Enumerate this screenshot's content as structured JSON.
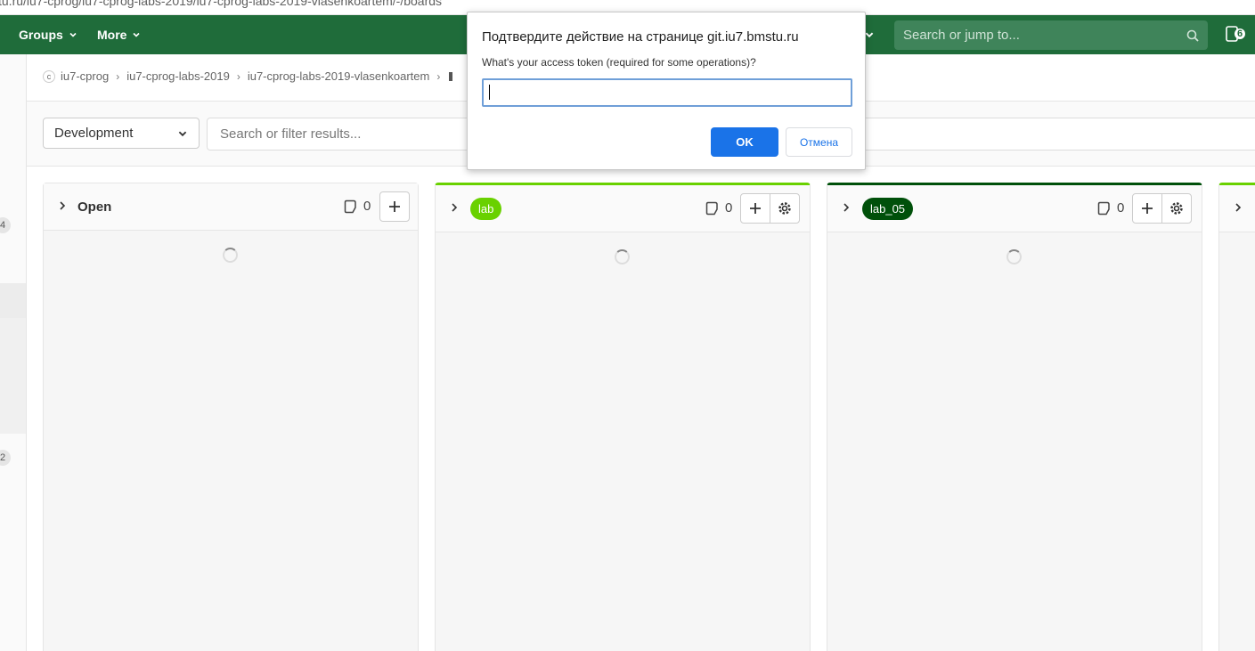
{
  "browser": {
    "url_fragment": "tu.ru/iu7-cprog/iu7-cprog-labs-2019/iu7-cprog-labs-2019-vlasenkoartem/-/boards"
  },
  "navbar": {
    "groups_label": "Groups",
    "more_label": "More",
    "search_placeholder": "Search or jump to...",
    "todo_count": "6",
    "bg_color": "#1f6c3a"
  },
  "sidebar": {
    "badge_top": "4",
    "badge_bottom": "2"
  },
  "breadcrumb": {
    "items": [
      "iu7-cprog",
      "iu7-cprog-labs-2019",
      "iu7-cprog-labs-2019-vlasenkoartem"
    ]
  },
  "filter": {
    "board_selector": "Development",
    "search_placeholder": "Search or filter results..."
  },
  "lists": [
    {
      "title": "Open",
      "count": "0",
      "type": "open"
    },
    {
      "title": "lab",
      "count": "0",
      "type": "label",
      "color": "#69d100"
    },
    {
      "title": "lab_05",
      "count": "0",
      "type": "label",
      "color": "#00500a"
    }
  ],
  "dialog": {
    "title": "Подтвердите действие на странице git.iu7.bmstu.ru",
    "message": "What's your access token (required for some operations)?",
    "input_value": "",
    "ok_label": "OK",
    "cancel_label": "Отмена"
  }
}
